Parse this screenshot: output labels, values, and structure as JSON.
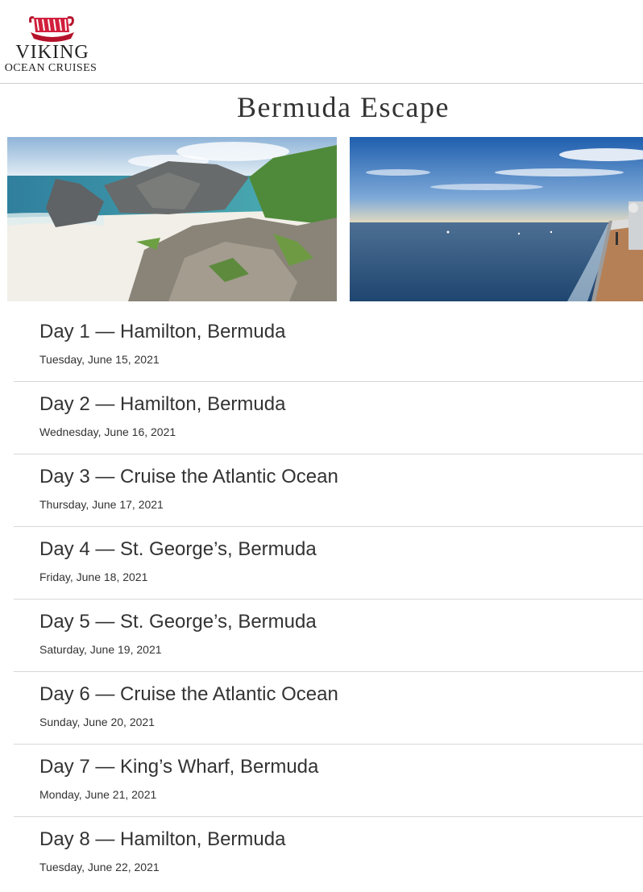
{
  "brand": {
    "name_line1": "VIKING",
    "name_line2": "OCEAN CRUISES",
    "accent": "#c8102e"
  },
  "page": {
    "title": "Bermuda Escape"
  },
  "images": [
    {
      "label": "Bermuda rocky beach"
    },
    {
      "label": "Ocean view from ship deck"
    }
  ],
  "itinerary": [
    {
      "title": "Day 1 — Hamilton, Bermuda",
      "date": "Tuesday, June 15, 2021"
    },
    {
      "title": "Day 2 — Hamilton, Bermuda",
      "date": "Wednesday, June 16, 2021"
    },
    {
      "title": "Day 3 — Cruise the Atlantic Ocean",
      "date": "Thursday, June 17, 2021"
    },
    {
      "title": "Day 4 — St. George’s, Bermuda",
      "date": "Friday, June 18, 2021"
    },
    {
      "title": "Day 5 — St. George’s, Bermuda",
      "date": "Saturday, June 19, 2021"
    },
    {
      "title": "Day 6 — Cruise the Atlantic Ocean",
      "date": "Sunday, June 20, 2021"
    },
    {
      "title": "Day 7 — King’s Wharf, Bermuda",
      "date": "Monday, June 21, 2021"
    },
    {
      "title": "Day 8 — Hamilton, Bermuda",
      "date": "Tuesday, June 22, 2021"
    }
  ]
}
